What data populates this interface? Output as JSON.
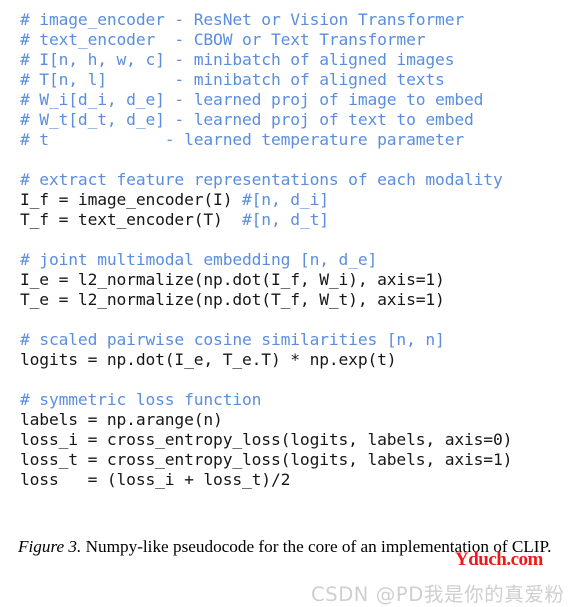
{
  "figure": {
    "background_color": "#ffffff",
    "comment_color": "#5b8ede",
    "code_color": "#171717"
  },
  "code": {
    "language": "python-pseudocode",
    "lines": [
      {
        "type": "comment",
        "text": "# image_encoder - ResNet or Vision Transformer"
      },
      {
        "type": "comment",
        "text": "# text_encoder  - CBOW or Text Transformer"
      },
      {
        "type": "comment",
        "text": "# I[n, h, w, c] - minibatch of aligned images"
      },
      {
        "type": "comment",
        "text": "# T[n, l]       - minibatch of aligned texts"
      },
      {
        "type": "comment",
        "text": "# W_i[d_i, d_e] - learned proj of image to embed"
      },
      {
        "type": "comment",
        "text": "# W_t[d_t, d_e] - learned proj of text to embed"
      },
      {
        "type": "comment",
        "text": "# t            - learned temperature parameter"
      },
      {
        "type": "blank",
        "text": ""
      },
      {
        "type": "comment",
        "text": "# extract feature representations of each modality"
      },
      {
        "type": "mixed",
        "code": "I_f = image_encoder(I) ",
        "comment": "#[n, d_i]"
      },
      {
        "type": "mixed",
        "code": "T_f = text_encoder(T)  ",
        "comment": "#[n, d_t]"
      },
      {
        "type": "blank",
        "text": ""
      },
      {
        "type": "comment",
        "text": "# joint multimodal embedding [n, d_e]"
      },
      {
        "type": "code",
        "text": "I_e = l2_normalize(np.dot(I_f, W_i), axis=1)"
      },
      {
        "type": "code",
        "text": "T_e = l2_normalize(np.dot(T_f, W_t), axis=1)"
      },
      {
        "type": "blank",
        "text": ""
      },
      {
        "type": "comment",
        "text": "# scaled pairwise cosine similarities [n, n]"
      },
      {
        "type": "code",
        "text": "logits = np.dot(I_e, T_e.T) * np.exp(t)"
      },
      {
        "type": "blank",
        "text": ""
      },
      {
        "type": "comment",
        "text": "# symmetric loss function"
      },
      {
        "type": "code",
        "text": "labels = np.arange(n)"
      },
      {
        "type": "code",
        "text": "loss_i = cross_entropy_loss(logits, labels, axis=0)"
      },
      {
        "type": "code",
        "text": "loss_t = cross_entropy_loss(logits, labels, axis=1)"
      },
      {
        "type": "code",
        "text": "loss   = (loss_i + loss_t)/2"
      }
    ]
  },
  "caption": {
    "label": "Figure 3.",
    "text": " Numpy-like pseudocode for the core of an implementation of CLIP."
  },
  "watermarks": {
    "red": {
      "text": "Yduch.com",
      "color": "#f01818"
    },
    "csdn": {
      "text": "CSDN @PD我是你的真爱粉",
      "color": "#cfcfcf"
    }
  }
}
